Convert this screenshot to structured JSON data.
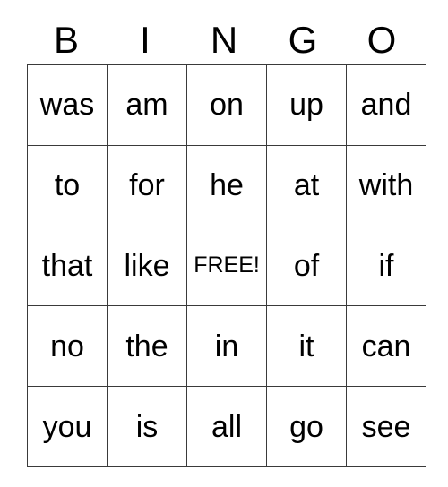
{
  "card": {
    "title": "BINGO",
    "header_letters": [
      "B",
      "I",
      "N",
      "G",
      "O"
    ],
    "free_space": {
      "label": "FREE!",
      "row": 2,
      "column": 2
    },
    "colors": {
      "background": "#ffffff",
      "text": "#000000",
      "grid_line": "#3a3a3a"
    },
    "columns": [
      {
        "letter": "B",
        "words": [
          "was",
          "to",
          "that",
          "no",
          "you"
        ]
      },
      {
        "letter": "I",
        "words": [
          "am",
          "for",
          "like",
          "the",
          "is"
        ]
      },
      {
        "letter": "N",
        "words": [
          "on",
          "he",
          "FREE!",
          "in",
          "all"
        ]
      },
      {
        "letter": "G",
        "words": [
          "up",
          "at",
          "of",
          "it",
          "go"
        ]
      },
      {
        "letter": "O",
        "words": [
          "and",
          "with",
          "if",
          "can",
          "see"
        ]
      }
    ],
    "rows": [
      [
        "was",
        "am",
        "on",
        "up",
        "and"
      ],
      [
        "to",
        "for",
        "he",
        "at",
        "with"
      ],
      [
        "that",
        "like",
        "FREE!",
        "of",
        "if"
      ],
      [
        "no",
        "the",
        "in",
        "it",
        "can"
      ],
      [
        "you",
        "is",
        "all",
        "go",
        "see"
      ]
    ]
  }
}
